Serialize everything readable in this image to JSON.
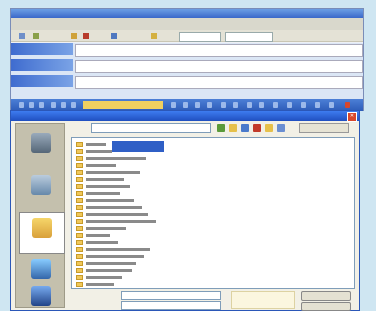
{
  "window": {
    "title": "",
    "menu": [
      "",
      "",
      "",
      "",
      "",
      "",
      "",
      ""
    ],
    "header_fields": [
      {
        "label": "",
        "value": ""
      },
      {
        "label": "",
        "value": ""
      },
      {
        "label": "",
        "value": ""
      }
    ]
  },
  "dialog": {
    "title": "",
    "look_in_label": "",
    "look_in_value": "",
    "tools_label": "",
    "places": [
      {
        "label": "",
        "icon": "recent-documents-icon"
      },
      {
        "label": "",
        "icon": "desktop-icon"
      },
      {
        "label": "",
        "icon": "my-documents-icon"
      },
      {
        "label": "",
        "icon": "my-computer-icon"
      },
      {
        "label": "",
        "icon": "network-places-icon"
      }
    ],
    "files": [
      "",
      "",
      "",
      "",
      "",
      "",
      "",
      "",
      "",
      "",
      "",
      "",
      "",
      "",
      "",
      "",
      "",
      "",
      "",
      "",
      ""
    ],
    "selected_file_index": 0,
    "file_name_label": "",
    "file_name_value": "",
    "file_type_label": "",
    "file_type_value": "",
    "open_label": "",
    "cancel_label": ""
  },
  "colors": {
    "background": "#cfe6f2",
    "title_bar": "#3a68c9",
    "dialog_title": "#1f4fc0",
    "selection": "#2f5fc6",
    "folder": "#f0c85a"
  }
}
